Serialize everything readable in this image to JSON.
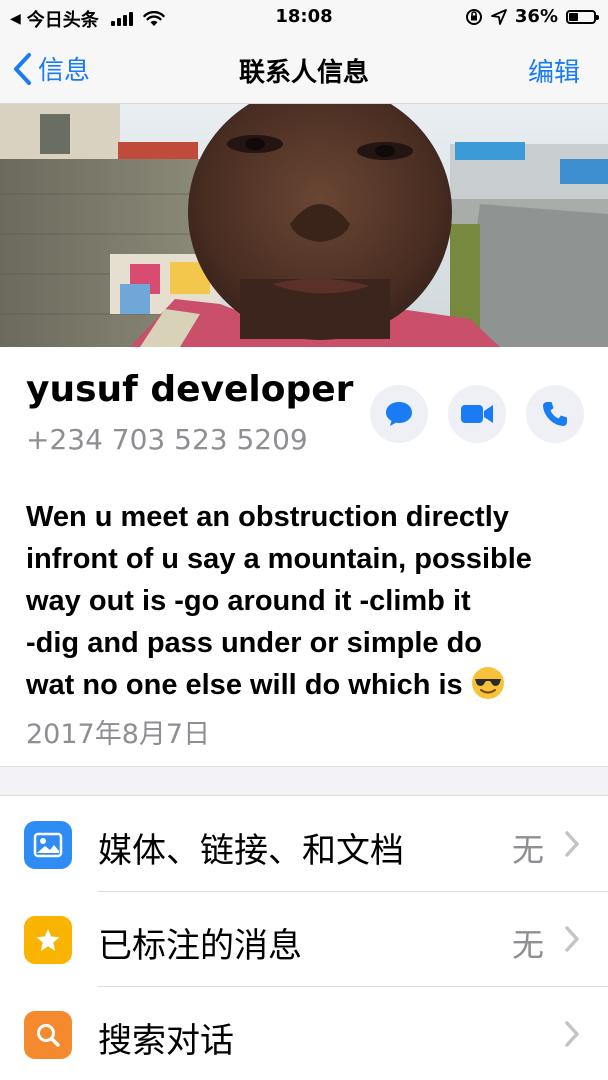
{
  "status_bar": {
    "carrier": "今日头条",
    "time": "18:08",
    "battery": "36%",
    "battery_level": 0.36
  },
  "nav": {
    "back_label": "信息",
    "title": "联系人信息",
    "edit_label": "编辑"
  },
  "contact": {
    "name": "yusuf developer",
    "phone": "+234 703 523 5209"
  },
  "about": {
    "lines": [
      "Wen u meet an obstruction directly",
      "infront of u say a mountain, possible",
      "way out is -go around it -climb it",
      "-dig and pass under or simple do",
      "wat no one else will do which is"
    ],
    "emoji": "smiling-face-with-sunglasses",
    "date": "2017年8月7日"
  },
  "list": [
    {
      "label": "媒体、链接、和文档",
      "value": "无",
      "icon": "photo-icon",
      "color": "#2f8cf5"
    },
    {
      "label": "已标注的消息",
      "value": "无",
      "icon": "star-icon",
      "color": "#f8b400"
    },
    {
      "label": "搜索对话",
      "value": "",
      "icon": "search-icon",
      "color": "#f5892e"
    }
  ],
  "colors": {
    "accent": "#1a7cf5",
    "secondary_text": "#8e8e93"
  }
}
